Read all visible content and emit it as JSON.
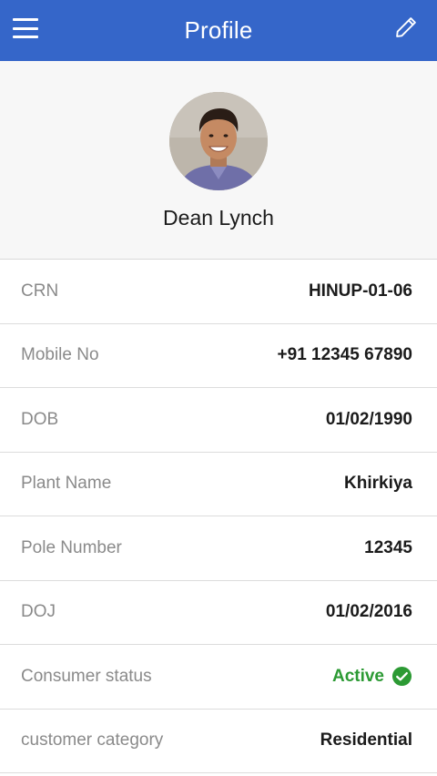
{
  "app_bar": {
    "title": "Profile",
    "menu_icon": "hamburger-menu-icon",
    "edit_icon": "pencil-icon",
    "color": "#3566c9"
  },
  "profile": {
    "name": "Dean Lynch",
    "avatar": "user-photo"
  },
  "details": [
    {
      "label": "CRN",
      "value": "HINUP-01-06"
    },
    {
      "label": "Mobile No",
      "value": "+91 12345 67890"
    },
    {
      "label": "DOB",
      "value": "01/02/1990"
    },
    {
      "label": "Plant Name",
      "value": "Khirkiya"
    },
    {
      "label": "Pole Number",
      "value": "12345"
    },
    {
      "label": "DOJ",
      "value": "01/02/2016"
    },
    {
      "label": "Consumer status",
      "value": "Active",
      "status_color": "#2c9a34",
      "status_icon": "check-circle-icon"
    },
    {
      "label": "customer category",
      "value": "Residential"
    }
  ]
}
